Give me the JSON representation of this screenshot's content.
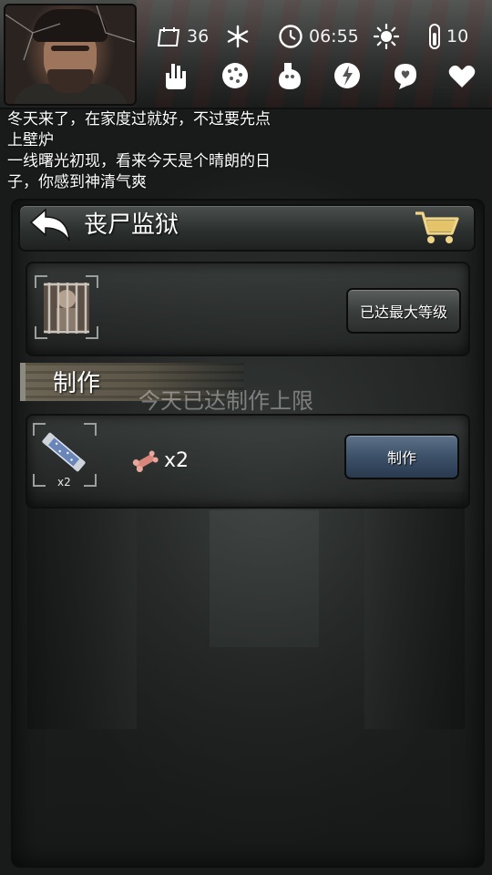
{
  "status": {
    "day": "36",
    "season_icon": "snowflake-icon",
    "time": "06:55",
    "weather_icon": "sun-icon",
    "temperature": "10"
  },
  "needs_icons": [
    "hand-icon",
    "stomach-icon",
    "ghost-icon",
    "fist-icon",
    "brain-icon",
    "heart-icon"
  ],
  "log": {
    "lines": [
      "冬天来了，在家度过就好，不过要先点",
      "上壁炉",
      "一线曙光初现，看来今天是个晴朗的日",
      "子，你感到神清气爽"
    ]
  },
  "page": {
    "title": "丧尸监狱"
  },
  "building": {
    "max_level_label": "已达最大等级"
  },
  "crafting": {
    "section_title": "制作",
    "limit_note": "今天已达制作上限",
    "product_count": "x2",
    "ingredient_icon": "flesh-icon",
    "ingredient_qty": "x2",
    "craft_label": "制作"
  },
  "colors": {
    "craft_button": "#3c5169",
    "grey_button": "#3a3e3c",
    "panel": "#2c302f"
  }
}
